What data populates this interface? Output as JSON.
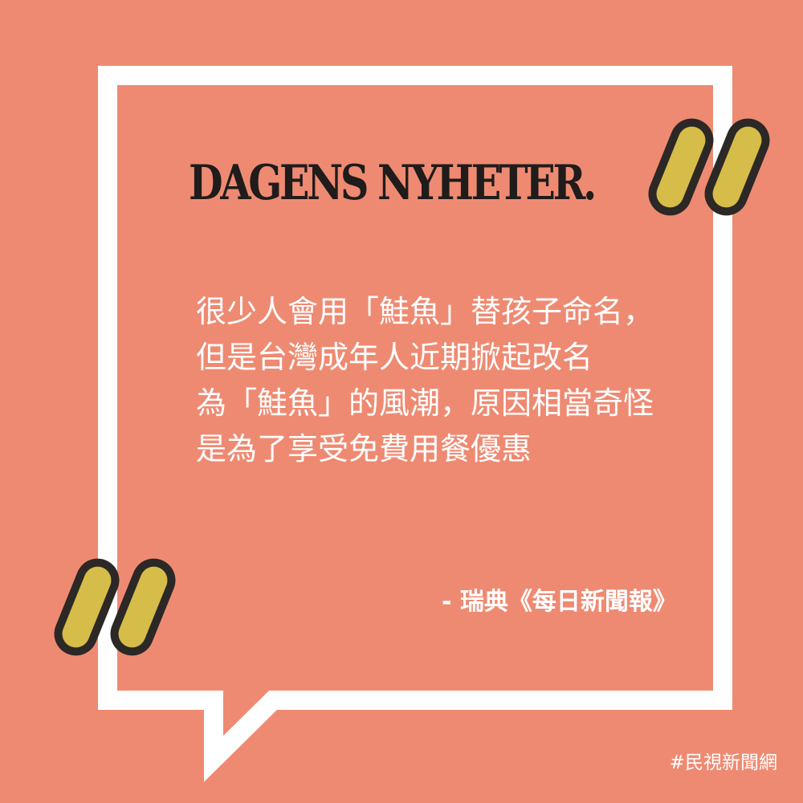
{
  "masthead": {
    "text": "DAGENS NYHETER."
  },
  "quote": {
    "lines": [
      "很少人會用「鮭魚」替孩子命名，",
      "但是台灣成年人近期掀起改名",
      "為「鮭魚」的風潮，原因相當奇怪",
      "是為了享受免費用餐優惠"
    ]
  },
  "attribution": {
    "text": "-  瑞典《每日新聞報》"
  },
  "hashtag": {
    "text": "#民視新聞網"
  },
  "colors": {
    "background": "#ef8a72",
    "bubble_outline": "#ffffff",
    "quote_mark_fill": "#d6bc49",
    "quote_mark_outline": "#2b2826",
    "masthead_text": "#1f1c1b",
    "body_text": "#ffffff"
  },
  "icons": {
    "speech_bubble": "speech-bubble-frame",
    "open_quote": "quote-mark-icon",
    "close_quote": "quote-mark-icon"
  }
}
